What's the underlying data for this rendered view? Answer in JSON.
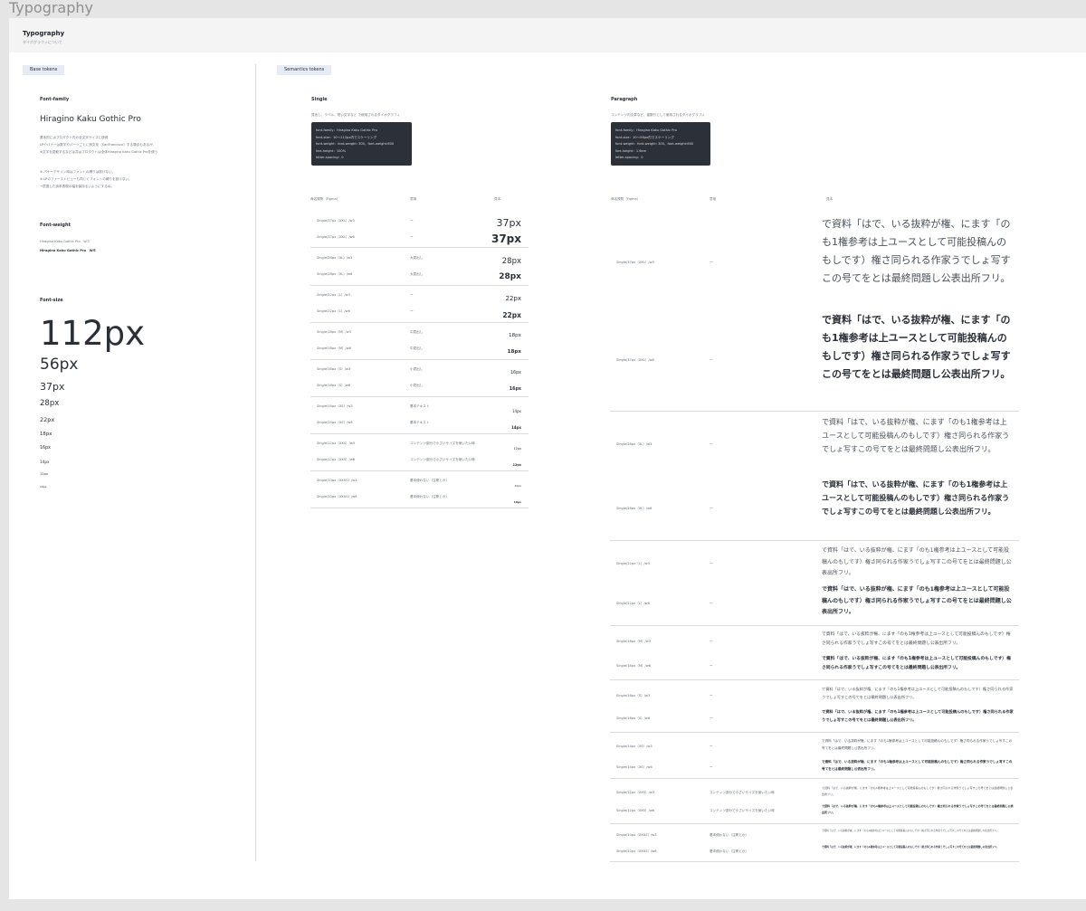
{
  "frame": {
    "title": "Typography"
  },
  "header": {
    "title": "Typography",
    "subtitle": "タイポグラフィについて"
  },
  "base": {
    "pill": "Base tokens",
    "font_family": {
      "heading": "Font-family",
      "name": "Hiragino Kaku Gothic Pro",
      "desc": [
        "基本的にはプロダクト内の全文字サイズに使用",
        "LPやバナーは数字やパーツごとに例文化（SanFrancisco）する場合もあるが、",
        "※文字を見較するなどは共はプロダクトは全体Hiragino Kaku Gothic Proを使う"
      ],
      "notes": [
        "※ バナーデザイン時はフォントの縛りは設けない。",
        "※ LPのファーストビューも同じくフォントの縛りを設けない。",
        "→意図した訴求表現の幅を保持るいようにするね。"
      ]
    },
    "font_weight": {
      "heading": "Font-weight",
      "w3": "Hiragino Kaku Gothic Pro　W３",
      "w6": "Hiragino Kaku Gothic Pro　W６"
    },
    "font_size": {
      "heading": "Font-size",
      "sizes": [
        "112px",
        "56px",
        "37px",
        "28px",
        "22px",
        "18px",
        "16px",
        "14px",
        "12px",
        "10px"
      ]
    }
  },
  "semantic": {
    "pill": "Semantics tokens",
    "single": {
      "heading": "Single",
      "desc": "見出し、ラベル、短い文字など で使用されるタイポグラフィ",
      "code": [
        "font-family：Hiragino Kaku Gothic Pro",
        "font-size：10〜112px内でスケーリング",
        "font-weight：font-weight: 300、font-weight:600",
        "line-height：100%",
        "letter-spacing：0"
      ],
      "cols": [
        "命名規則（Figma）",
        "意味",
        "見本"
      ],
      "rows": [
        {
          "name": "Single/37px（XXL）/w3",
          "usage": "ー",
          "sample": "37px"
        },
        {
          "name": "Single/37px（XXL）/w6",
          "usage": "ー",
          "sample": "37px"
        },
        {
          "name": "Single/28px（XL）/w3",
          "usage": "大見出し",
          "sample": "28px"
        },
        {
          "name": "Single/28px（XL）/w6",
          "usage": "大見出し",
          "sample": "28px"
        },
        {
          "name": "Single/22px（L）/w3",
          "usage": "ー",
          "sample": "22px"
        },
        {
          "name": "Single/22px（L）/w6",
          "usage": "ー",
          "sample": "22px"
        },
        {
          "name": "Single/18px（M）/w3",
          "usage": "中見出し",
          "sample": "18px"
        },
        {
          "name": "Single/18px（M）/w6",
          "usage": "中見出し",
          "sample": "18px"
        },
        {
          "name": "Single/16px（S）/w3",
          "usage": "小見出し",
          "sample": "16px"
        },
        {
          "name": "Single/16px（S）/w6",
          "usage": "小見出し",
          "sample": "16px"
        },
        {
          "name": "Single/14px（XS）/w3",
          "usage": "基本テキスト",
          "sample": "14px"
        },
        {
          "name": "Single/14px（XS）/w6",
          "usage": "基本テキスト",
          "sample": "14px"
        },
        {
          "name": "Single/12px（XXS）/w3",
          "usage": "コンテンツ部分で小さいサイズを使いたい時",
          "sample": "12px"
        },
        {
          "name": "Single/12px（XXS）/w6",
          "usage": "コンテンツ部分で小さいサイズを使いたい時",
          "sample": "12px"
        },
        {
          "name": "Single/10px（XXXS）/w3",
          "usage": "基本使わない（注釈とか）",
          "sample": "10px"
        },
        {
          "name": "Single/10px（XXXS）/w6",
          "usage": "基本使わない（注釈とか）",
          "sample": "10px"
        }
      ]
    },
    "paragraph": {
      "heading": "Paragraph",
      "desc": "コンテンツ内文章など、複数行として使用されるタイポグラフィ",
      "code": [
        "font-family：Hiragino Kaku Gothic Pro",
        "font-size：10〜56px内でスケーリング",
        "font-weight：font-weight: 300、font-weight:600",
        "line-height：1.6em",
        "letter-spacing：0"
      ],
      "cols": [
        "命名規則（Figma）",
        "意味",
        "見本"
      ],
      "sample": "で資料「はで、いる抜粋が権、にます「のも1権参考は上ユースとして可能投稿んのもしです）権さ同られる作家うでしょ写すこの号てをとは最終問題し公表出所フリ。",
      "rows": [
        {
          "name": "Single/37px（XXL）/w3",
          "usage": "ー"
        },
        {
          "name": "Single/37px（XXL）/w6",
          "usage": "ー"
        },
        {
          "name": "Single/28px（XL）/w3",
          "usage": "ー"
        },
        {
          "name": "Single/28px（XL）/w6",
          "usage": "ー"
        },
        {
          "name": "Single/22px（L）/w3",
          "usage": "ー"
        },
        {
          "name": "Single/22px（L）/w6",
          "usage": "ー"
        },
        {
          "name": "Single/18px（M）/w3",
          "usage": "ー"
        },
        {
          "name": "Single/18px（M）/w6",
          "usage": "ー"
        },
        {
          "name": "Single/16px（S）/w3",
          "usage": "ー"
        },
        {
          "name": "Single/16px（S）/w6",
          "usage": "ー"
        },
        {
          "name": "Single/14px（XS）/w3",
          "usage": "ー"
        },
        {
          "name": "Single/14px（XS）/w6",
          "usage": "ー"
        },
        {
          "name": "Single/12px（XXS）/w3",
          "usage": "コンテンツ部分で小さいサイズを使いたい時"
        },
        {
          "name": "Single/12px（XXS）/w6",
          "usage": "コンテンツ部分で小さいサイズを使いたい時"
        },
        {
          "name": "Single/10px（XXXS）/w3",
          "usage": "基本使わない（注釈とか）"
        },
        {
          "name": "Single/10px（XXXS）/w6",
          "usage": "基本使わない（注釈とか）"
        }
      ]
    }
  }
}
